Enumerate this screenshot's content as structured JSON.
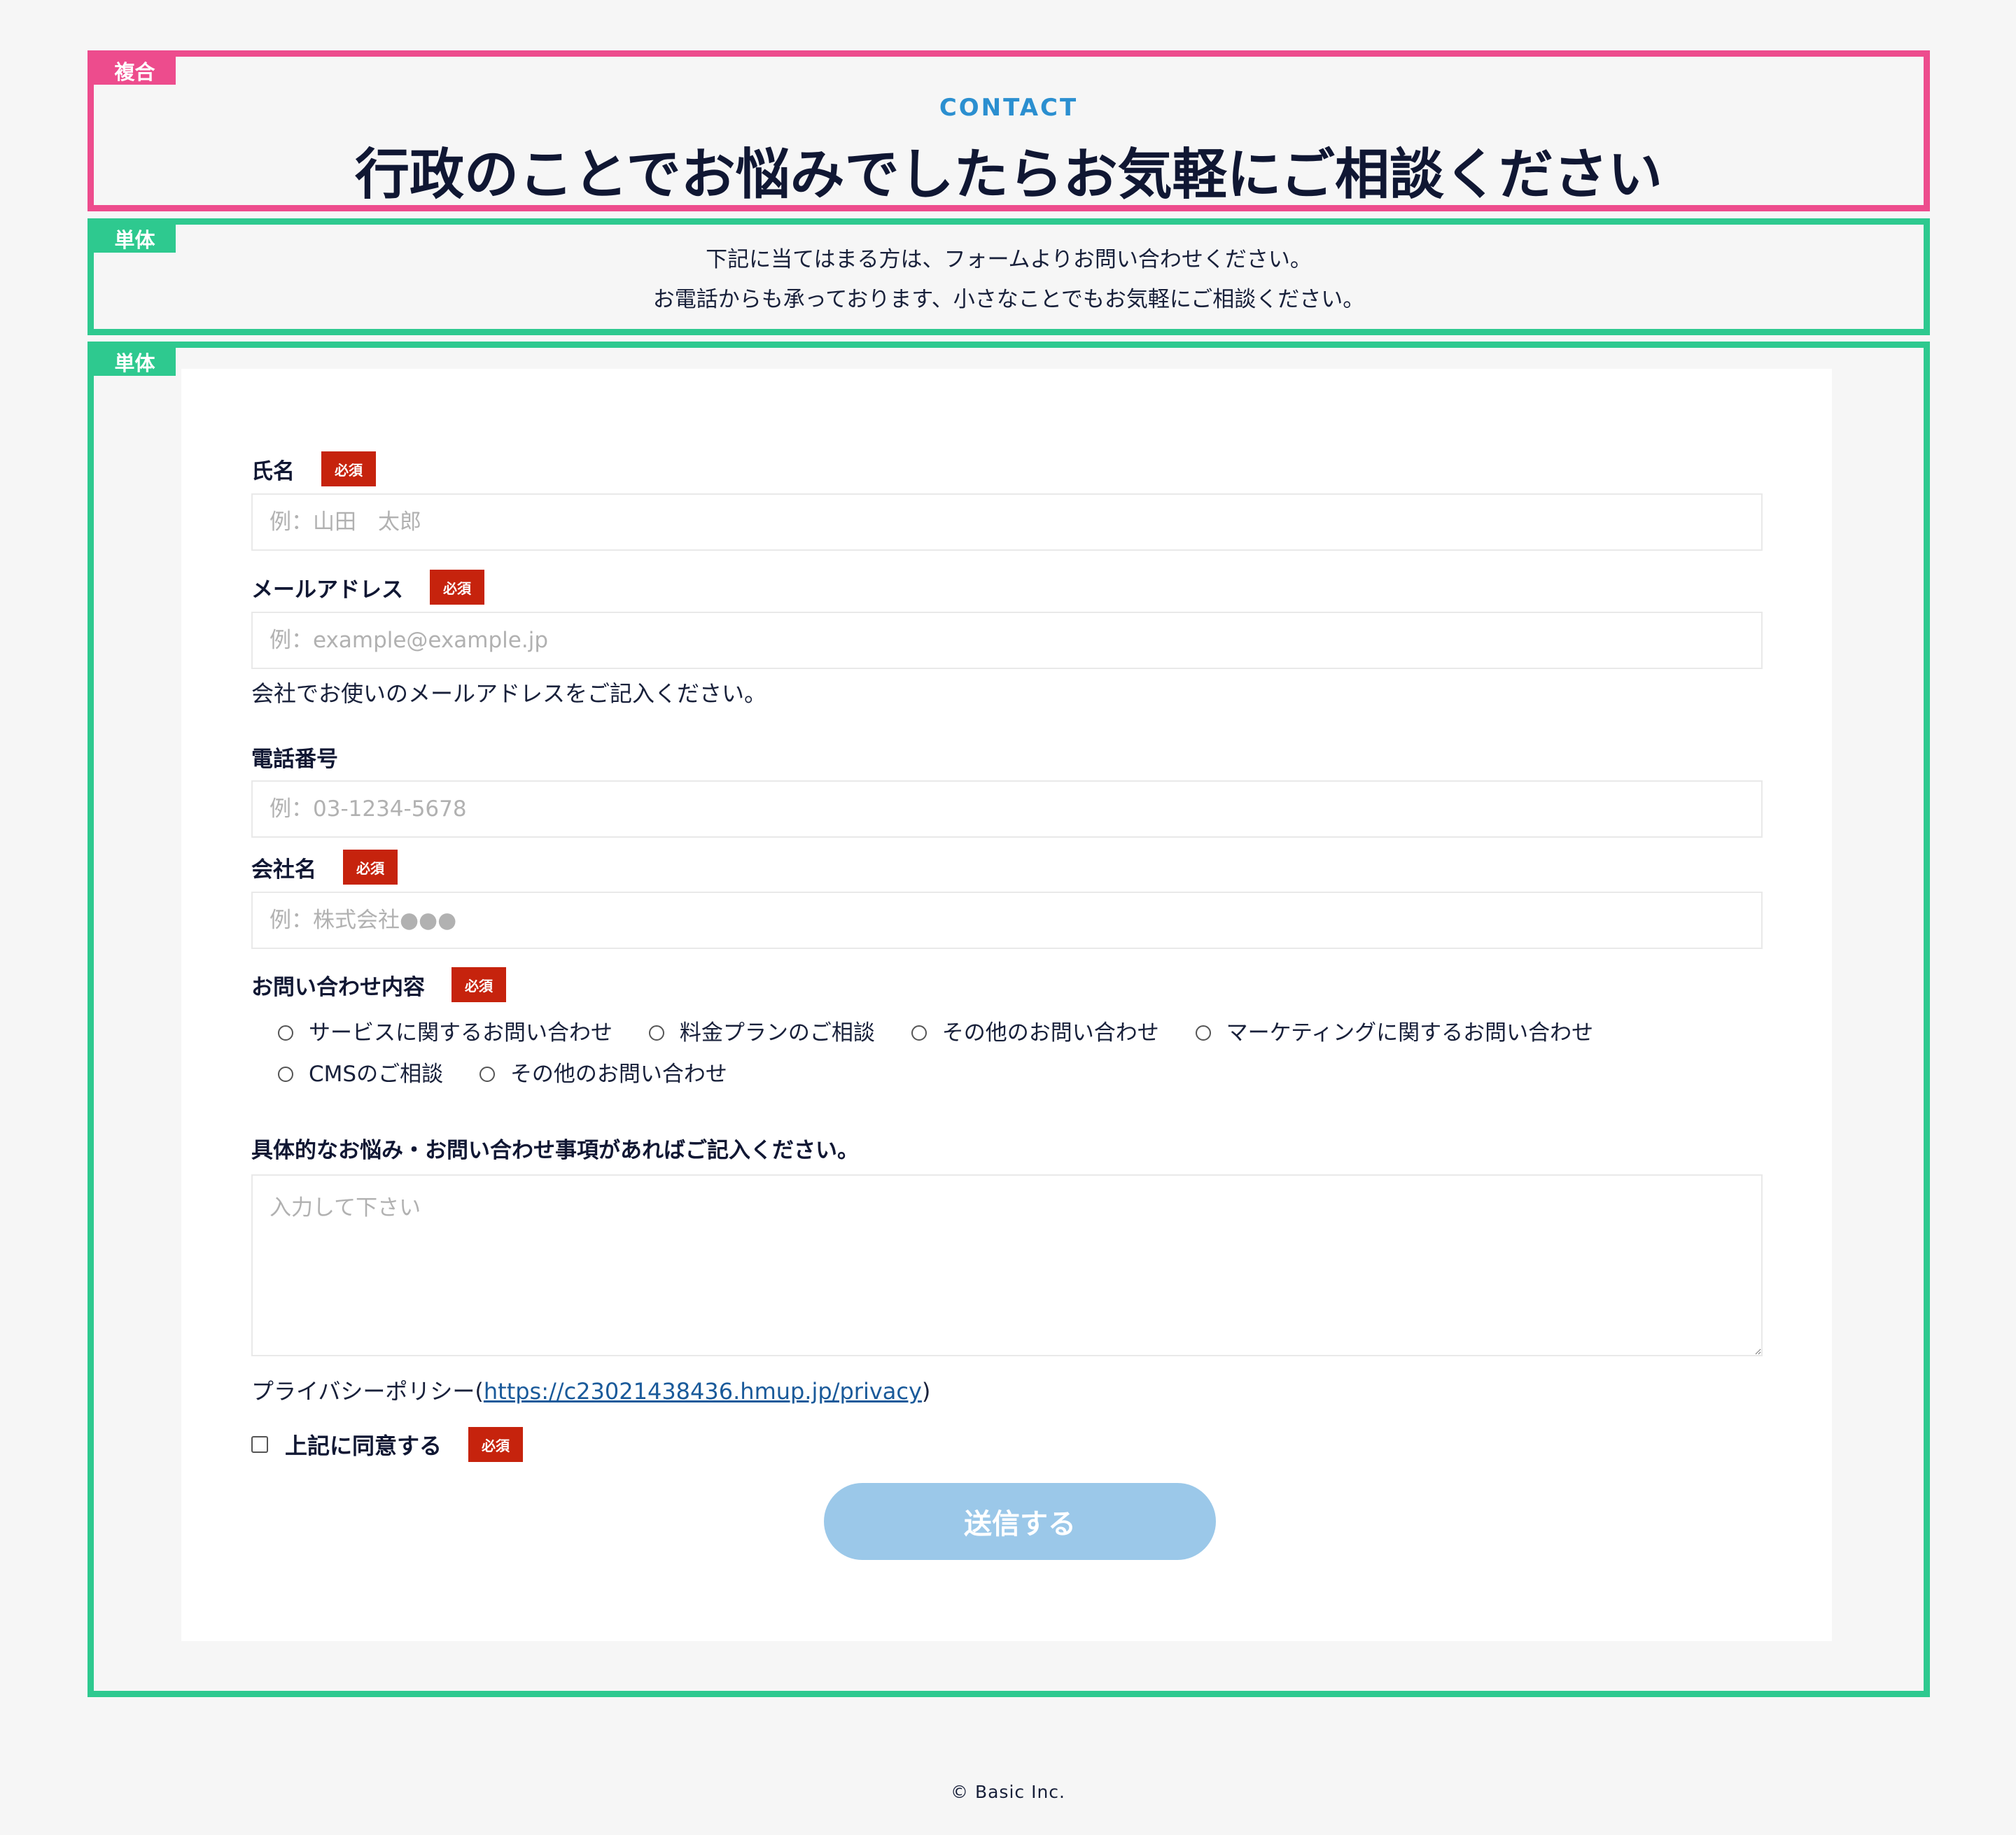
{
  "section_heading": {
    "tag": "複合",
    "eyebrow": "CONTACT",
    "title": "行政のことでお悩みでしたらお気軽にご相談ください"
  },
  "section_intro": {
    "tag": "単体",
    "line1": "下記に当てはまる方は、フォームよりお問い合わせください。",
    "line2": "お電話からも承っております、小さなことでもお気軽にご相談ください。"
  },
  "section_form": {
    "tag": "単体",
    "required_badge": "必須",
    "name": {
      "label": "氏名",
      "placeholder": "例：山田　太郎"
    },
    "email": {
      "label": "メールアドレス",
      "placeholder": "例：example@example.jp",
      "help": "会社でお使いのメールアドレスをご記入ください。"
    },
    "phone": {
      "label": "電話番号",
      "placeholder": "例：03-1234-5678"
    },
    "company": {
      "label": "会社名",
      "placeholder": "例：株式会社●●●"
    },
    "inquiry_type": {
      "label": "お問い合わせ内容",
      "options": [
        "サービスに関するお問い合わせ",
        "料金プランのご相談",
        "その他のお問い合わせ",
        "マーケティングに関するお問い合わせ",
        "CMSのご相談",
        "その他のお問い合わせ"
      ]
    },
    "details": {
      "label": "具体的なお悩み・お問い合わせ事項があればご記入ください。",
      "placeholder": "入力して下さい"
    },
    "privacy": {
      "prefix": "プライバシーポリシー(",
      "link": "https://c23021438436.hmup.jp/privacy",
      "suffix": ")"
    },
    "agree_label": "上記に同意する",
    "submit_label": "送信する"
  },
  "footer": {
    "copyright": "© Basic Inc."
  }
}
